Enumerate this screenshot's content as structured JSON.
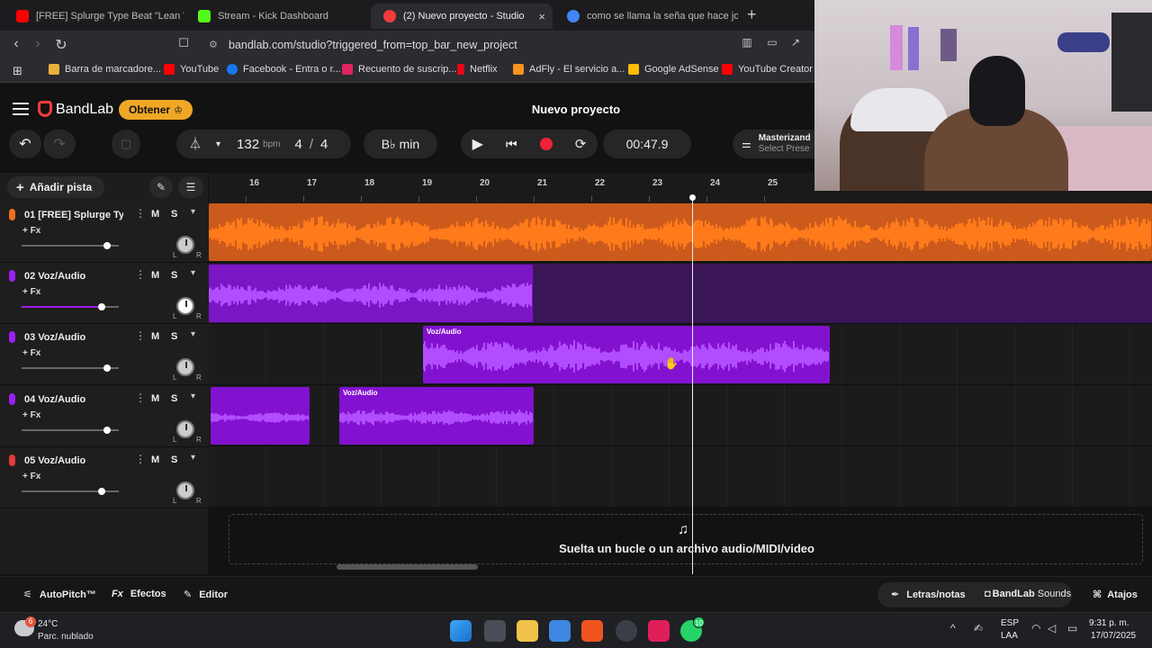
{
  "browser": {
    "tabs": [
      {
        "title": "[FREE] Splurge Type Beat \"Lean Wit It\"",
        "color": "#ff0000"
      },
      {
        "title": "Stream - Kick Dashboard",
        "color": "#53fc18"
      },
      {
        "title": "(2) Nuevo proyecto - Studio",
        "color": "#f23c3c",
        "close": "×"
      },
      {
        "title": "como se llama la seña que hace jonh",
        "color": "#4285f4"
      }
    ],
    "new_tab": "+",
    "url": "bandlab.com/studio?triggered_from=top_bar_new_project",
    "bookmarks": [
      {
        "label": "Barra de marcadore...",
        "color": "#e8b23a"
      },
      {
        "label": "YouTube",
        "color": "#ff0000"
      },
      {
        "label": "Facebook - Entra o r...",
        "color": "#1877f2"
      },
      {
        "label": "Recuento de suscrip...",
        "color": "#e0245e"
      },
      {
        "label": "Netflix",
        "color": "#e50914"
      },
      {
        "label": "AdFly - El servicio a...",
        "color": "#f7931e"
      },
      {
        "label": "Google AdSense",
        "color": "#fbbc04"
      },
      {
        "label": "YouTube Creator St",
        "color": "#ff0000"
      }
    ]
  },
  "app": {
    "logo": "BandLab",
    "upgrade_label": "Obtener",
    "project_title": "Nuevo proyecto",
    "bpm_value": "132",
    "bpm_unit": "bpm",
    "time_sig_top": "4",
    "time_sig_sep": "/",
    "time_sig_bottom": "4",
    "key": "B♭ min",
    "time": "00:47.9",
    "mastering_label": "Masterizand",
    "mastering_sub": "Select Prese",
    "add_track": "Añadir pista",
    "accent": "#f2623a"
  },
  "ruler": {
    "bars": [
      "16",
      "17",
      "18",
      "19",
      "20",
      "21",
      "22",
      "23",
      "24",
      "25"
    ]
  },
  "tracks": [
    {
      "name": "01  [FREE] Splurge Typ...",
      "fx": "+ Fx",
      "mute": "M",
      "solo": "S",
      "color": "#f07020",
      "volume": 0.88
    },
    {
      "name": "02  Voz/Audio",
      "fx": "+ Fx",
      "mute": "M",
      "solo": "S",
      "color": "#9b1ef2",
      "volume": 0.82
    },
    {
      "name": "03  Voz/Audio",
      "fx": "+ Fx",
      "mute": "M",
      "solo": "S",
      "color": "#9b1ef2",
      "volume": 0.88
    },
    {
      "name": "04  Voz/Audio",
      "fx": "+ Fx",
      "mute": "M",
      "solo": "S",
      "color": "#9b1ef2",
      "volume": 0.88
    },
    {
      "name": "05  Voz/Audio",
      "fx": "+ Fx",
      "mute": "M",
      "solo": "S",
      "color": "#e23a3a",
      "volume": 0.82
    }
  ],
  "region_label": "Voz/Audio",
  "pan_l": "L",
  "pan_r": "R",
  "dropzone_text": "Suelta un bucle o un archivo audio/MIDI/video",
  "bottom": {
    "autopitch": "AutoPitch™",
    "effects": "Efectos",
    "editor": "Editor",
    "lyrics": "Letras/notas",
    "sounds_bold": "BandLab",
    "sounds": "Sounds",
    "shortcuts": "Atajos"
  },
  "taskbar": {
    "weather_badge": "6",
    "temp": "24°C",
    "weather": "Parc. nublado",
    "lang1": "ESP",
    "lang2": "LAA",
    "time": "9:31 p. m.",
    "date": "17/07/2025",
    "whatsapp_badge": "10"
  }
}
